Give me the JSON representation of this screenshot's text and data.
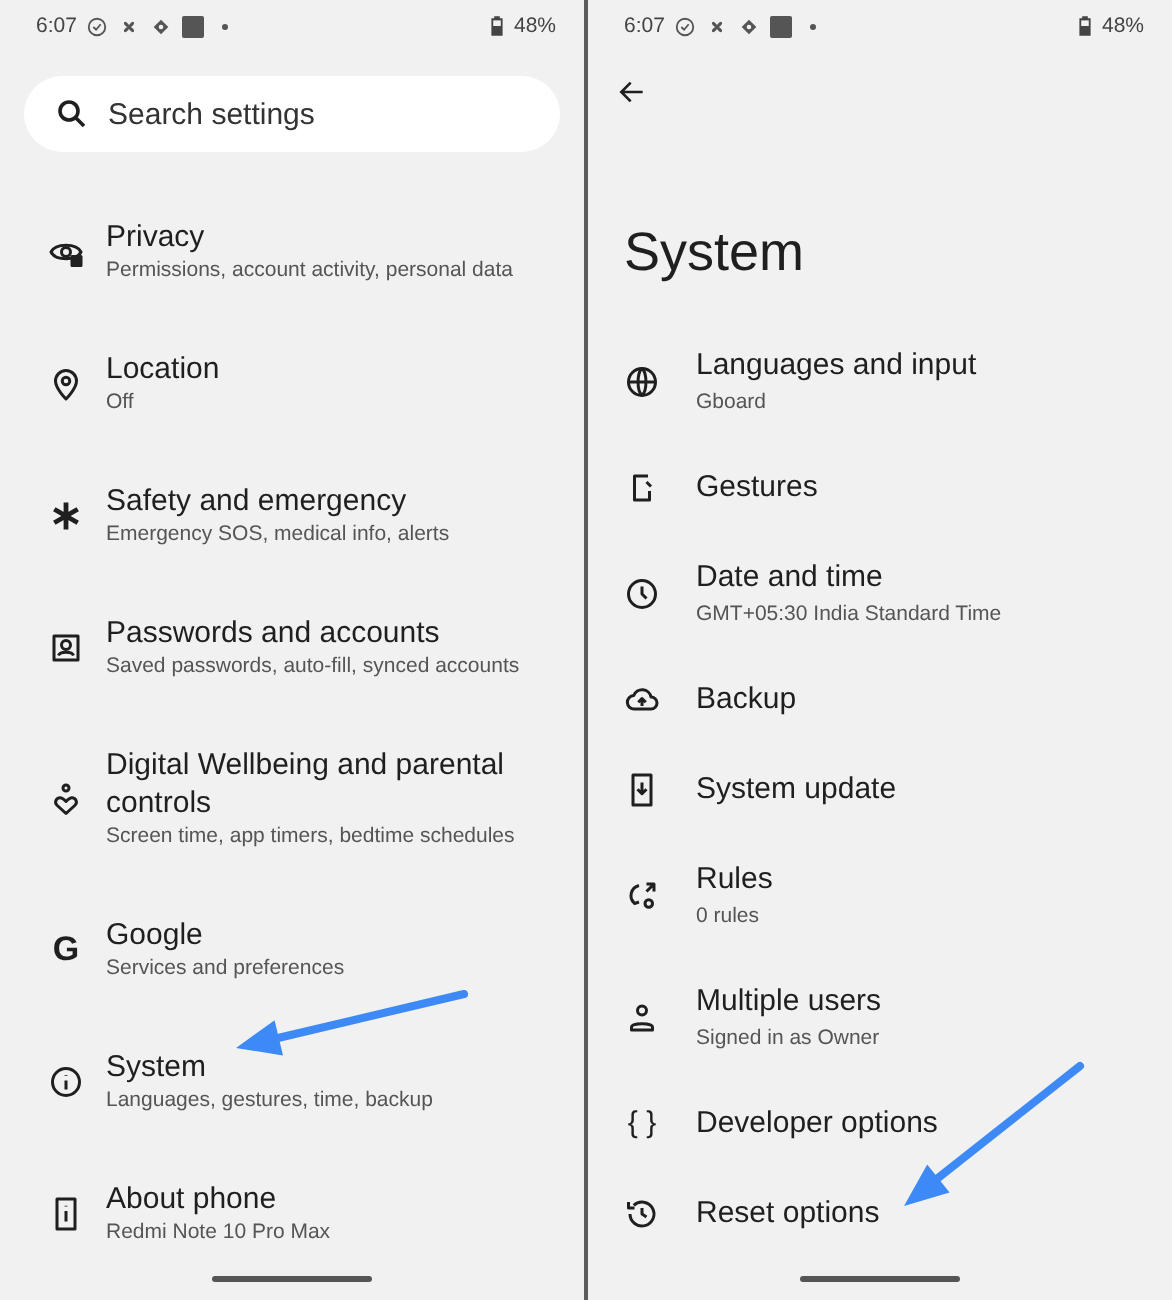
{
  "left_screen": {
    "status_bar": {
      "time": "6:07",
      "battery": "48%"
    },
    "search": {
      "placeholder": "Search settings"
    },
    "items": [
      {
        "title": "Privacy",
        "subtitle": "Permissions, account activity, personal data"
      },
      {
        "title": "Location",
        "subtitle": "Off"
      },
      {
        "title": "Safety and emergency",
        "subtitle": "Emergency SOS, medical info, alerts"
      },
      {
        "title": "Passwords and accounts",
        "subtitle": "Saved passwords, auto-fill, synced accounts"
      },
      {
        "title": "Digital Wellbeing and parental controls",
        "subtitle": "Screen time, app timers, bedtime schedules"
      },
      {
        "title": "Google",
        "subtitle": "Services and preferences",
        "icon_glyph": "G"
      },
      {
        "title": "System",
        "subtitle": "Languages, gestures, time, backup"
      },
      {
        "title": "About phone",
        "subtitle": "Redmi Note 10 Pro Max"
      }
    ]
  },
  "right_screen": {
    "status_bar": {
      "time": "6:07",
      "battery": "48%"
    },
    "title": "System",
    "items": [
      {
        "title": "Languages and input",
        "subtitle": "Gboard"
      },
      {
        "title": "Gestures"
      },
      {
        "title": "Date and time",
        "subtitle": "GMT+05:30 India Standard Time"
      },
      {
        "title": "Backup"
      },
      {
        "title": "System update"
      },
      {
        "title": "Rules",
        "subtitle": "0 rules"
      },
      {
        "title": "Multiple users",
        "subtitle": "Signed in as Owner"
      },
      {
        "title": "Developer options",
        "icon_glyph": "{ }"
      },
      {
        "title": "Reset options"
      }
    ]
  }
}
